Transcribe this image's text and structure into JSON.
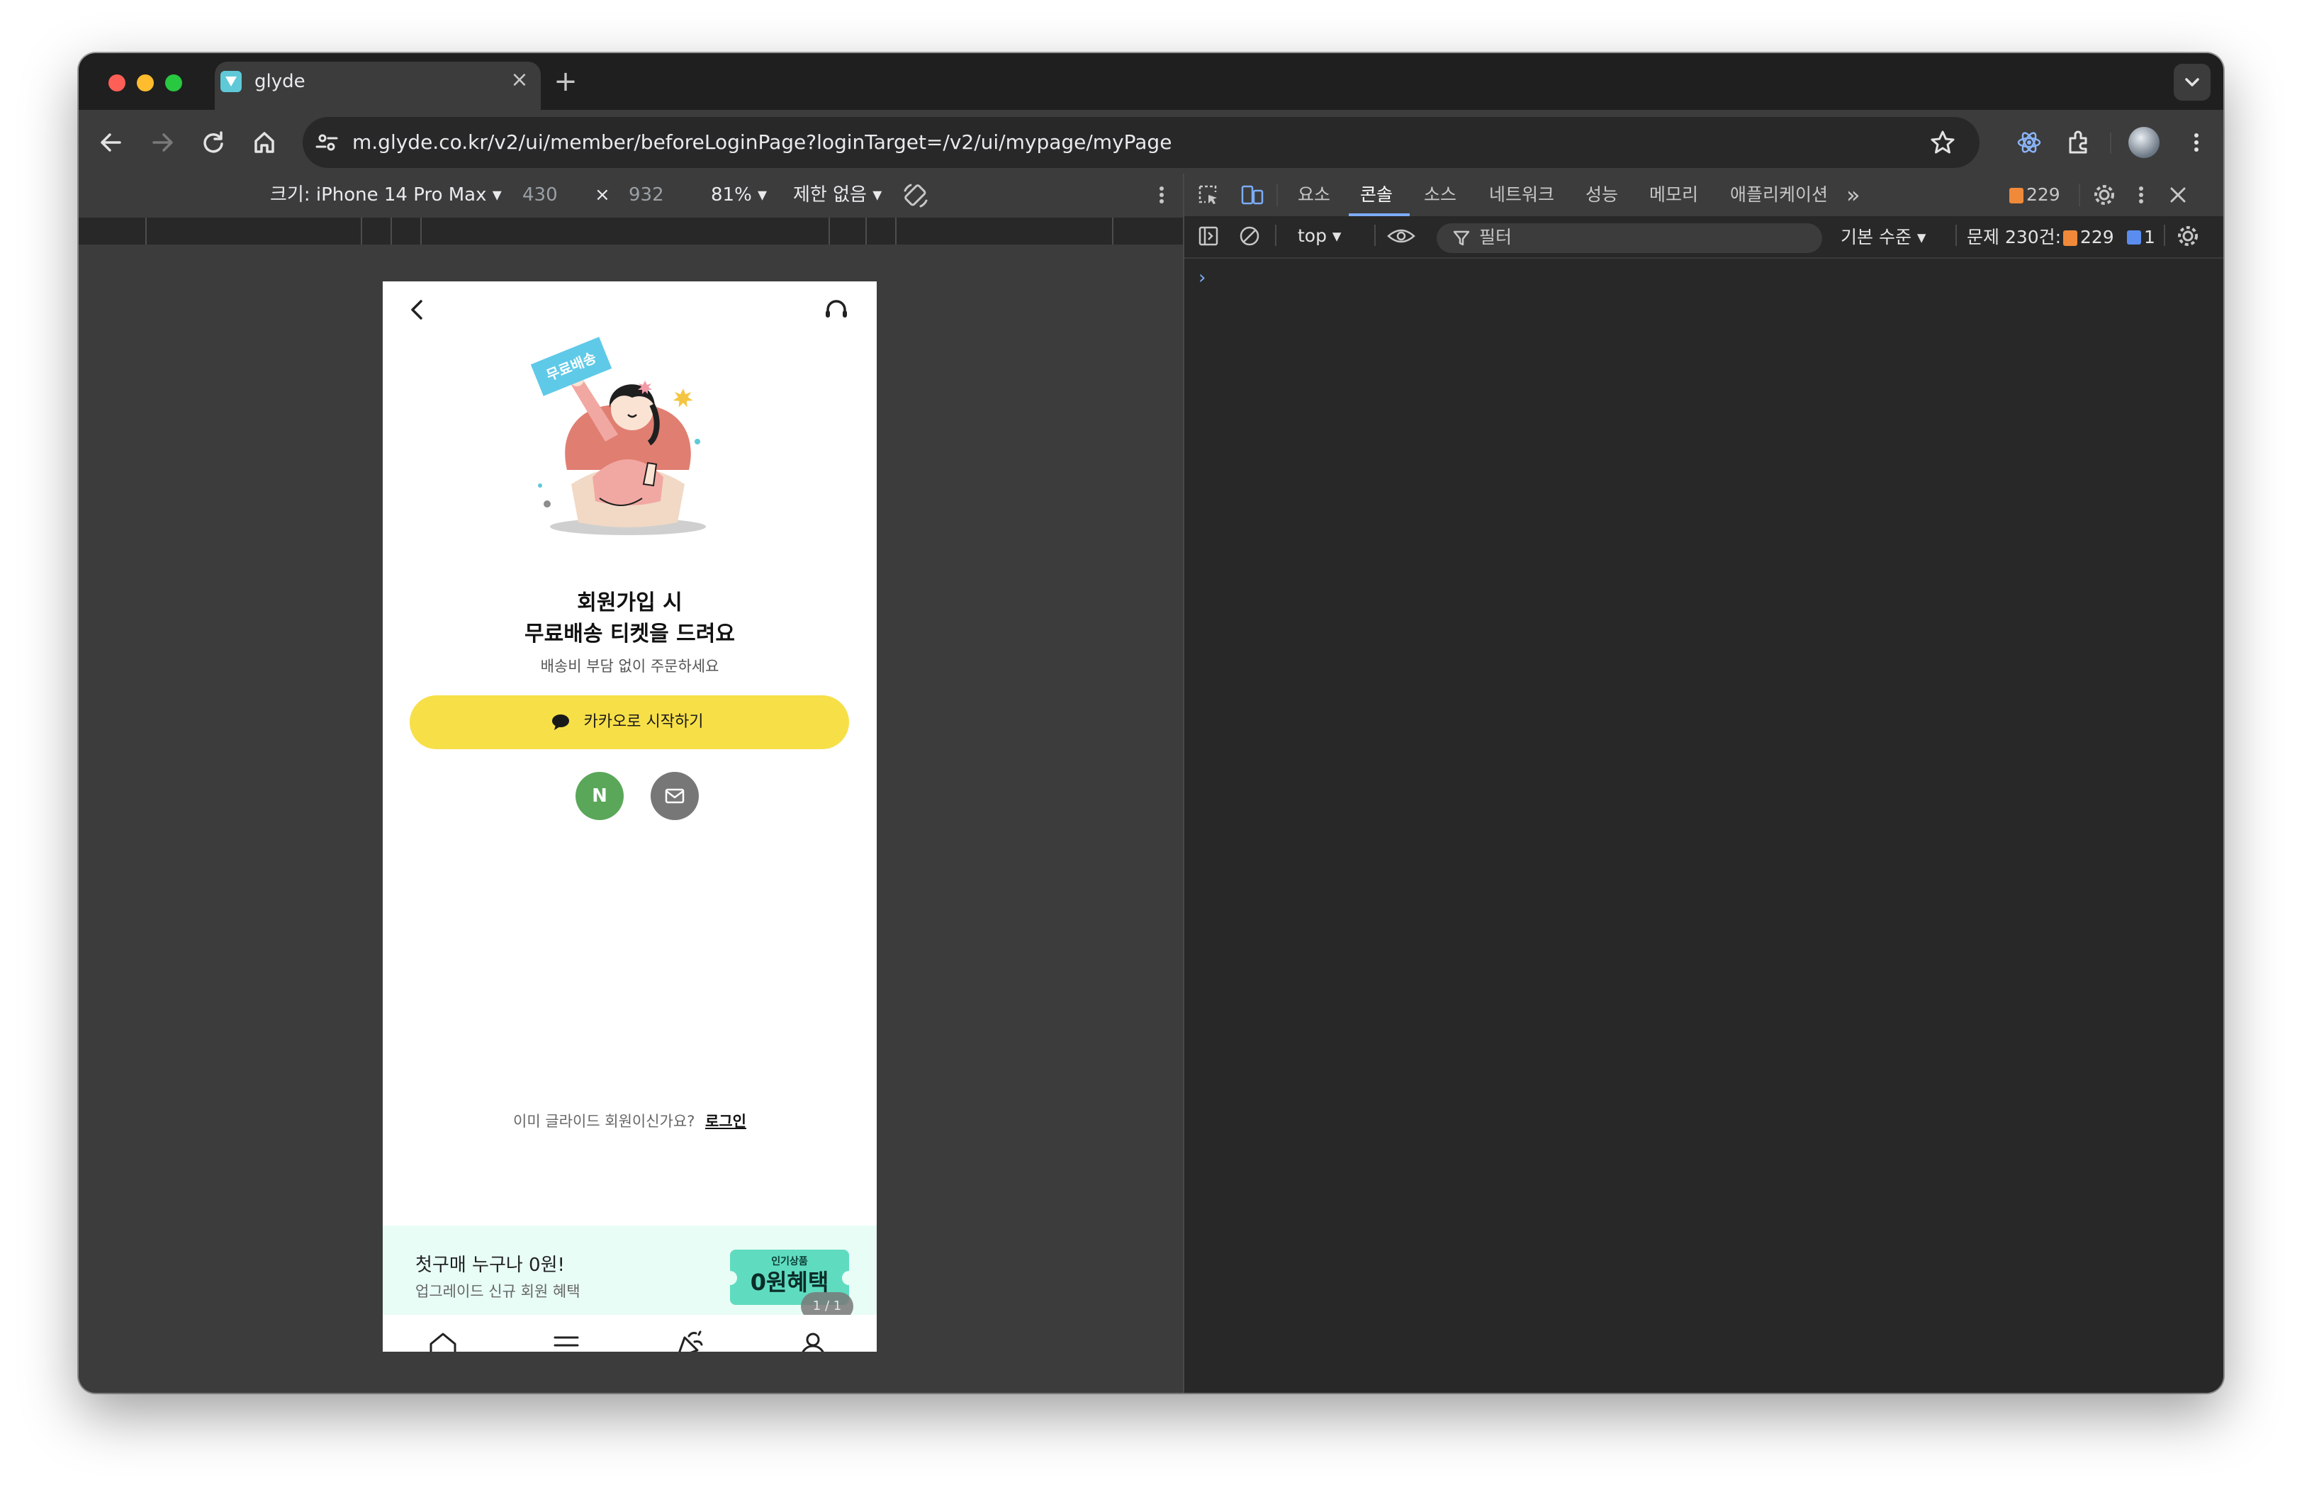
{
  "browser": {
    "tab_title": "glyde",
    "tab_close": "×",
    "new_tab": "+",
    "url": "m.glyde.co.kr/v2/ui/member/beforeLoginPage?loginTarget=/v2/ui/mypage/myPage"
  },
  "device_toolbar": {
    "device_label": "크기: iPhone 14 Pro Max ▾",
    "width": "430",
    "times": "×",
    "height": "932",
    "zoom": "81% ▾",
    "throttle": "제한 없음 ▾"
  },
  "phone": {
    "sticker_text": "무료배송",
    "headline_line1": "회원가입 시",
    "headline_line2": "무료배송 티켓을 드려요",
    "subtext": "배송비 부담 없이 주문하세요",
    "kakao_label": "카카오로 시작하기",
    "naver_label": "N",
    "already_text": "이미 글라이드 회원이신가요?",
    "login_link": "로그인",
    "banner": {
      "title": "첫구매 누구나 0원!",
      "subtitle": "업그레이드 신규 회원 혜택",
      "ticket_top": "인기상품",
      "ticket_main": "0원혜택",
      "pager": "1 / 1"
    },
    "nav_items": [
      "home-icon",
      "menu-icon",
      "event-icon",
      "my-page-icon"
    ]
  },
  "devtools": {
    "tabs": [
      "요소",
      "콘솔",
      "소스",
      "네트워크",
      "성능",
      "메모리",
      "애플리케이션"
    ],
    "active_tab": "콘솔",
    "more_tabs": "»",
    "warning_count": "229",
    "context": "top ▾",
    "filter_placeholder": "필터",
    "log_level": "기본 수준 ▾",
    "issues_label": "문제 230건:",
    "issues_warnings": "229",
    "issues_info": "1",
    "prompt": "›"
  },
  "colors": {
    "kakao": "#f7df48",
    "naver": "#5aa75a",
    "email": "#777777",
    "banner_bg": "#e8fdf6",
    "ticket": "#5fdcc0",
    "devtools_accent": "#7cacf8",
    "warning": "#f08a3a"
  }
}
